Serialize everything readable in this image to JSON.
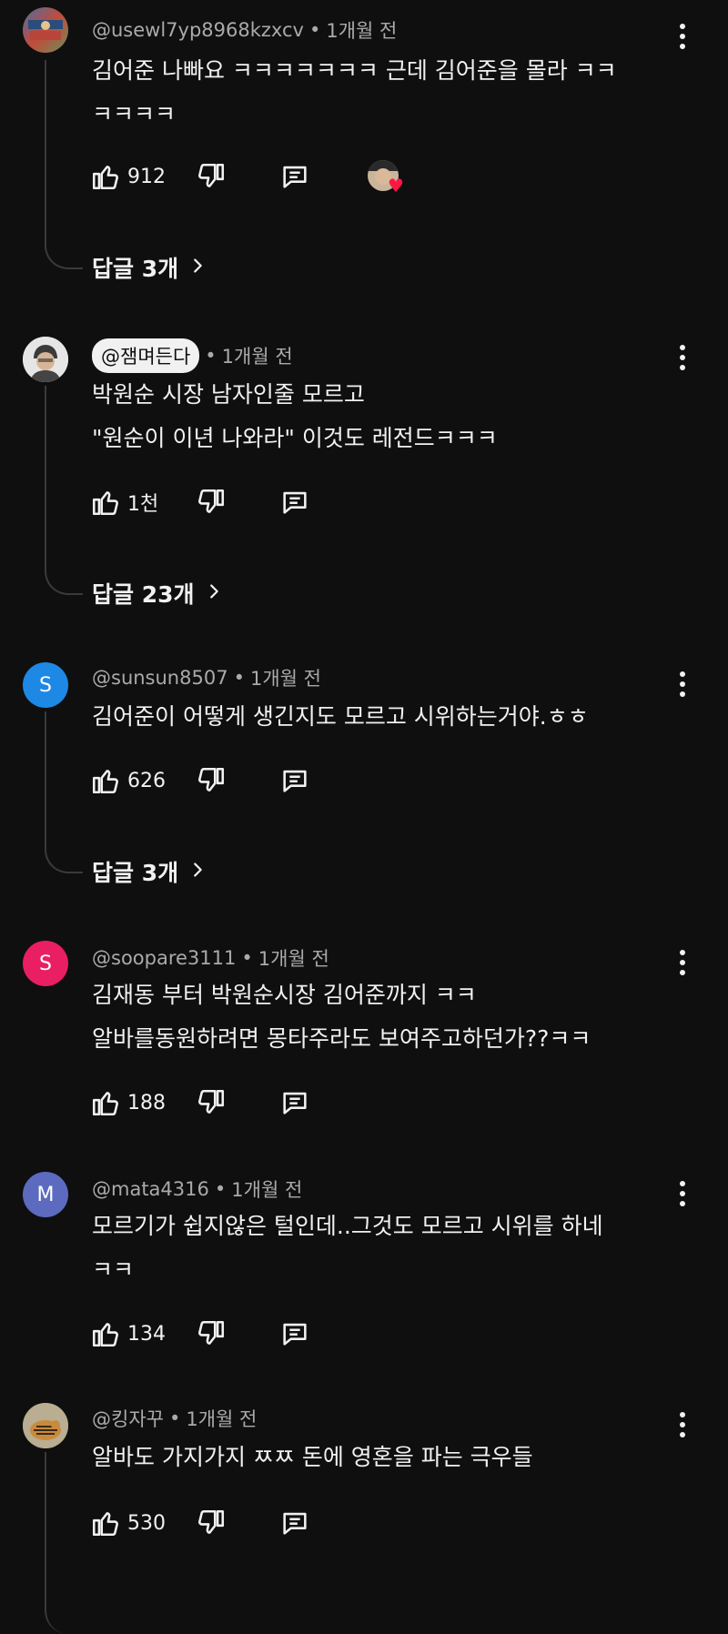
{
  "comments": [
    {
      "handle": "@usewl7yp8968kzxcv",
      "time": "1개월 전",
      "text": "김어준 나빠요 ㅋㅋㅋㅋㅋㅋㅋ 근데 김어준을 몰라 ㅋㅋ\nㅋㅋㅋㅋ",
      "likes": "912",
      "replies": "답글 3개"
    },
    {
      "handle": "@잼며든다",
      "time": "1개월 전",
      "text": "박원순 시장 남자인줄 모르고\n\"원순이 이년 나와라\" 이것도 레전드ㅋㅋㅋ",
      "likes": "1천",
      "replies": "답글 23개"
    },
    {
      "handle": "@sunsun8507",
      "time": "1개월 전",
      "avatar_letter": "S",
      "avatar_color": "#1e88e5",
      "text": "김어준이 어떻게 생긴지도 모르고 시위하는거야.ㅎㅎ",
      "likes": "626",
      "replies": "답글 3개"
    },
    {
      "handle": "@soopare3111",
      "time": "1개월 전",
      "avatar_letter": "S",
      "avatar_color": "#e91e63",
      "text": "김재동 부터 박원순시장 김어준까지 ㅋㅋ\n알바를동원하려면 몽타주라도 보여주고하던가??ㅋㅋ",
      "likes": "188"
    },
    {
      "handle": "@mata4316",
      "time": "1개월 전",
      "avatar_letter": "M",
      "avatar_color": "#5c6bc0",
      "text": "모르기가 쉽지않은 털인데..그것도 모르고 시위를 하네\nㅋㅋ",
      "likes": "134"
    },
    {
      "handle": "@킹자꾸",
      "time": "1개월 전",
      "text": "알바도 가지가지 ㅉㅉ 돈에 영혼을 파는 극우들",
      "likes": "530"
    }
  ],
  "separator": "•",
  "icons": [
    "thumbs-up-icon",
    "thumbs-down-icon",
    "reply-icon",
    "more-vert-icon",
    "chevron-right-icon",
    "heart-icon"
  ],
  "colors": {
    "background": "#0f0f0f",
    "text": "#f1f1f1",
    "secondary": "#aaaaaa",
    "heart": "#ff1744"
  }
}
